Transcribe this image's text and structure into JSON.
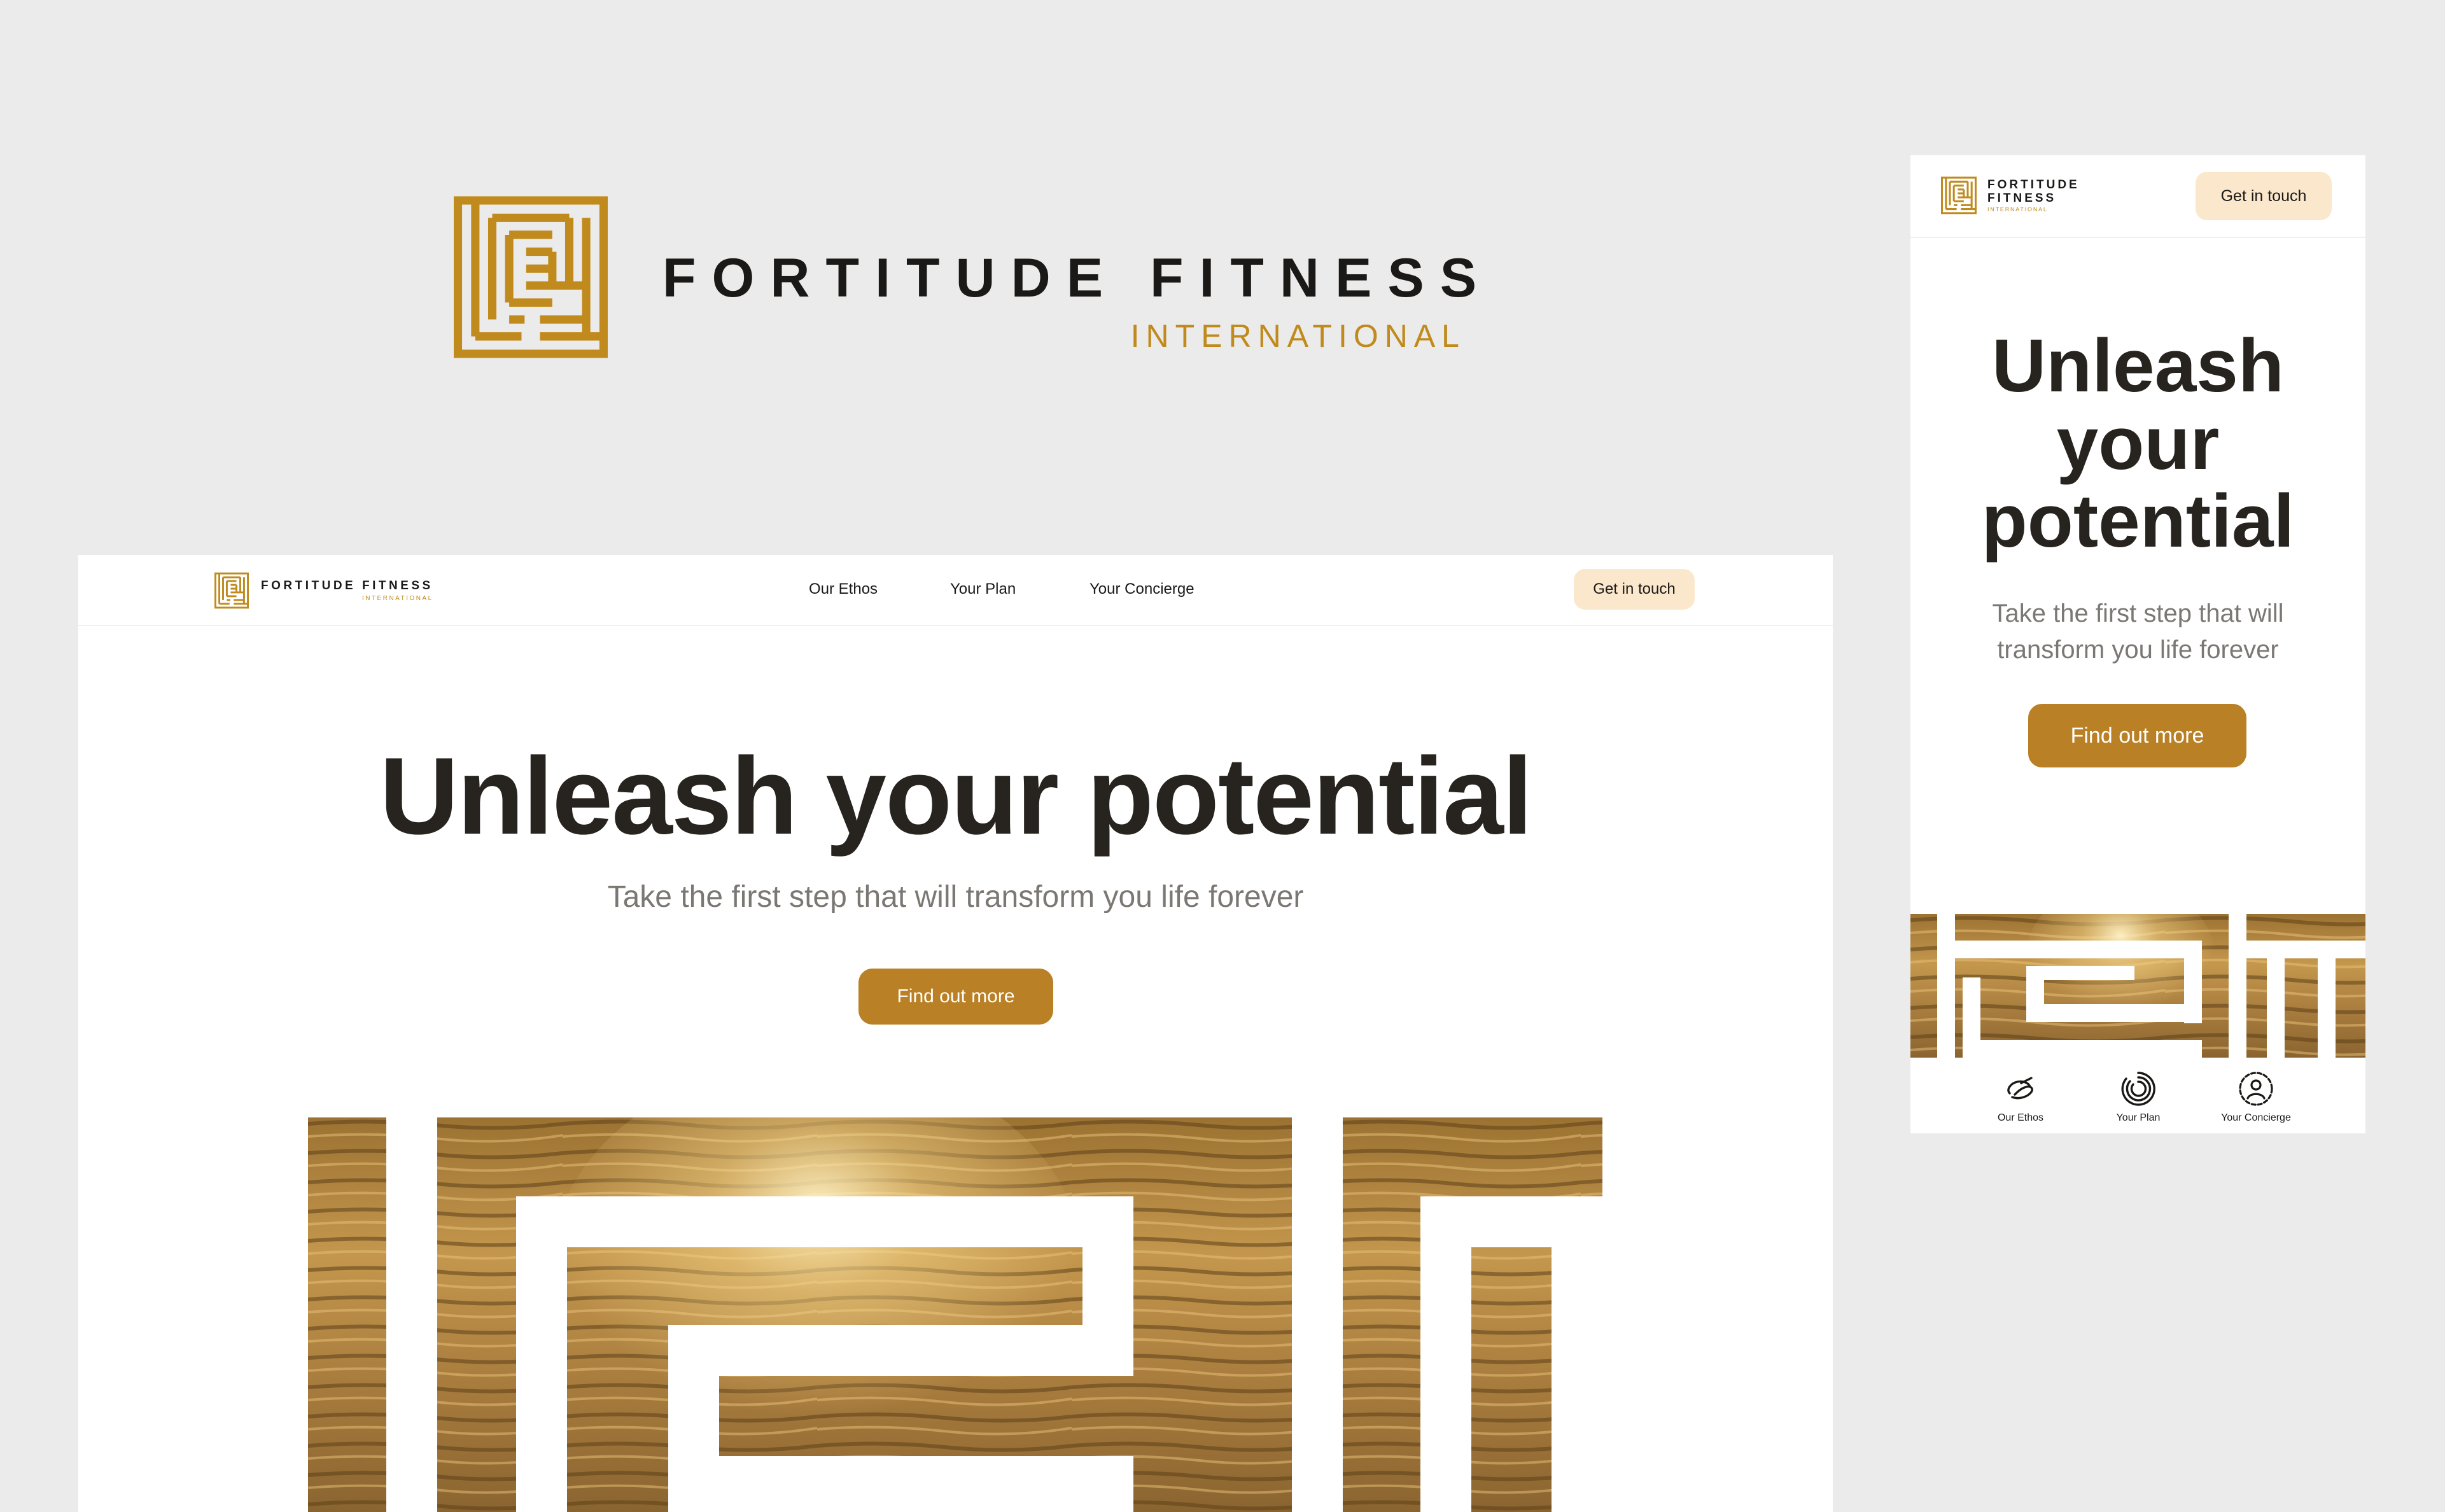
{
  "brand": {
    "name": "FORTITUDE FITNESS",
    "sub": "INTERNATIONAL",
    "logo_icon": "fortitude-maze-logo-icon",
    "color_gold": "#c08a1c",
    "color_dark": "#1b1917"
  },
  "desktop": {
    "logo_name": "FORTITUDE FITNESS",
    "logo_sub": "INTERNATIONAL",
    "nav": [
      "Our Ethos",
      "Your Plan",
      "Your Concierge"
    ],
    "cta": "Get in touch",
    "hero_title": "Unleash your potential",
    "hero_subtitle": "Take the first step that will transform you life forever",
    "hero_button": "Find out more",
    "hero_image": "sunlit-beach-waves-maze-cutout"
  },
  "mobile": {
    "logo_line1": "FORTITUDE",
    "logo_line2": "FITNESS",
    "logo_sub": "INTERNATIONAL",
    "cta": "Get in touch",
    "hero_title": "Unleash your potential",
    "hero_subtitle": "Take the first step that will transform you life forever",
    "hero_button": "Find out more",
    "hero_image": "sunlit-beach-waves-maze-cutout",
    "tabs": [
      {
        "label": "Our Ethos",
        "icon": "ethos-icon"
      },
      {
        "label": "Your Plan",
        "icon": "plan-spiral-icon"
      },
      {
        "label": "Your Concierge",
        "icon": "concierge-person-icon"
      }
    ]
  },
  "colors": {
    "page_bg": "#ebebeb",
    "cta_bg": "#fbe7cc",
    "button_bg": "#b98025",
    "heading": "#27231f",
    "subtext": "#7b7874"
  }
}
